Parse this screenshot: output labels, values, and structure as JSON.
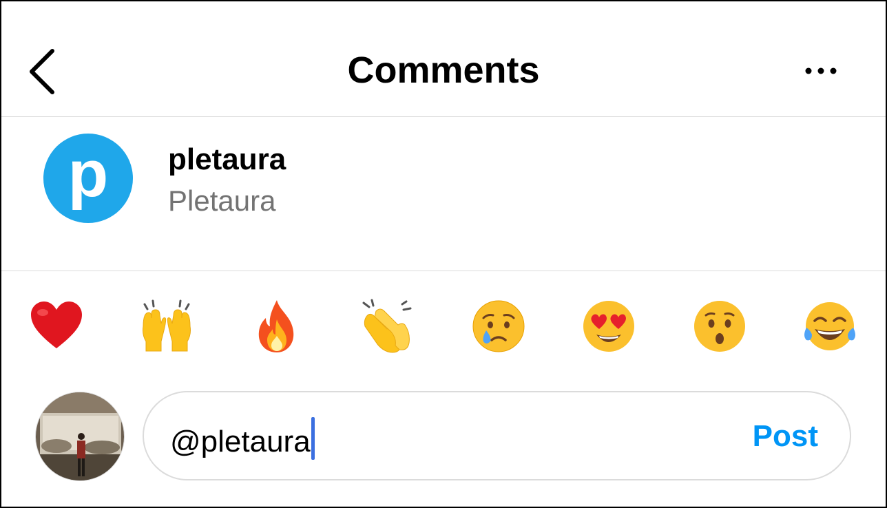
{
  "header": {
    "title": "Comments",
    "back_icon": "chevron-left-icon",
    "more_icon": "more-horizontal-icon"
  },
  "suggestion": {
    "avatar_letter": "p",
    "avatar_color": "#1fa7ea",
    "username": "pletaura",
    "full_name": "Pletaura"
  },
  "emojis": [
    {
      "name": "red-heart-emoji"
    },
    {
      "name": "raising-hands-emoji"
    },
    {
      "name": "fire-emoji"
    },
    {
      "name": "clapping-hands-emoji"
    },
    {
      "name": "crying-face-emoji"
    },
    {
      "name": "heart-eyes-emoji"
    },
    {
      "name": "surprised-face-emoji"
    },
    {
      "name": "tears-of-joy-emoji"
    }
  ],
  "composer": {
    "value": "@pletaura",
    "post_label": "Post",
    "post_color": "#0095f6"
  }
}
